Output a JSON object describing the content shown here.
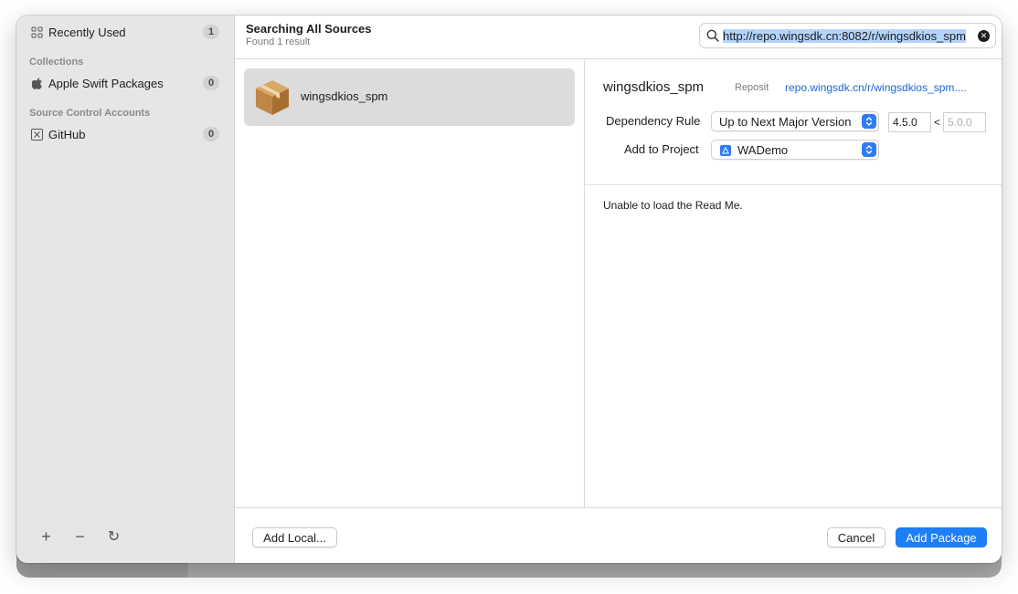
{
  "sidebar": {
    "recent": {
      "label": "Recently Used",
      "count": "1",
      "icon": "grid-icon"
    },
    "collections_header": "Collections",
    "collections": [
      {
        "label": "Apple Swift Packages",
        "count": "0",
        "icon": "apple-icon"
      }
    ],
    "accounts_header": "Source Control Accounts",
    "accounts": [
      {
        "label": "GitHub",
        "count": "0",
        "icon": "github-icon"
      }
    ],
    "actions": {
      "add": "+",
      "remove": "−",
      "refresh": "↻"
    }
  },
  "header": {
    "title": "Searching All Sources",
    "subtitle": "Found 1 result",
    "search_value": "http://repo.wingsdk.cn:8082/r/wingsdkios_spm"
  },
  "packages": [
    {
      "name": "wingsdkios_spm",
      "icon": "package-box-icon"
    }
  ],
  "details": {
    "name": "wingsdkios_spm",
    "repo_label": "Reposit",
    "repo_link": "repo.wingsdk.cn/r/wingsdkios_spm....",
    "dependency_rule_label": "Dependency Rule",
    "dependency_rule_value": "Up to Next Major Version",
    "version_from": "4.5.0",
    "version_separator": "<",
    "version_to": "5.0.0",
    "add_to_project_label": "Add to Project",
    "add_to_project_value": "WADemo",
    "readme_message": "Unable to load the Read Me."
  },
  "footer": {
    "add_local": "Add Local...",
    "cancel": "Cancel",
    "add_package": "Add Package"
  },
  "colors": {
    "accent": "#1e7ef5",
    "link": "#1a66d2",
    "selection": "#b3d4fc",
    "package_icon": "#c8934f"
  }
}
